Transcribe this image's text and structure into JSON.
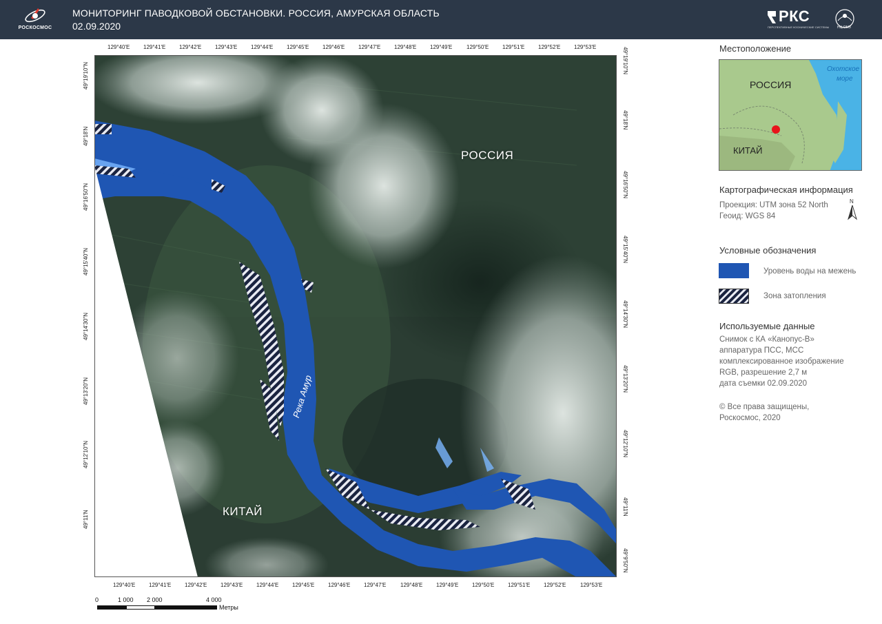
{
  "header": {
    "logo_left_text": "РОСКОСМОС",
    "title": "МОНИТОРИНГ ПАВОДКОВОЙ ОБСТАНОВКИ. РОССИЯ, АМУРСКАЯ ОБЛАСТЬ",
    "date": "02.09.2020",
    "logo_right_text": "РКС",
    "logo_right_sub": "ПЕРСПЕКТИВНЫЕ КОСМИЧЕСКИЕ СИСТЕМЫ",
    "emblem_text": "НЦ ОМЗ"
  },
  "map": {
    "label_russia": "РОССИЯ",
    "label_china": "КИТАЙ",
    "river_label": "Река Амур",
    "lon_ticks_top": [
      "129°40'E",
      "129°41'E",
      "129°42'E",
      "129°43'E",
      "129°44'E",
      "129°45'E",
      "129°46'E",
      "129°47'E",
      "129°48'E",
      "129°49'E",
      "129°50'E",
      "129°51'E",
      "129°52'E",
      "129°53'E"
    ],
    "lon_ticks_bottom": [
      "129°40'E",
      "129°41'E",
      "129°42'E",
      "129°43'E",
      "129°44'E",
      "129°45'E",
      "129°46'E",
      "129°47'E",
      "129°48'E",
      "129°49'E",
      "129°50'E",
      "129°51'E",
      "129°52'E",
      "129°53'E"
    ],
    "lat_ticks_left": [
      "49°19'10\"N",
      "49°18'N",
      "49°16'50\"N",
      "49°15'40\"N",
      "49°14'30\"N",
      "49°13'20\"N",
      "49°12'10\"N",
      "49°11'N"
    ],
    "lat_ticks_right": [
      "49°19'10\"N",
      "49°18'N",
      "49°16'50\"N",
      "49°15'40\"N",
      "49°14'30\"N",
      "49°13'20\"N",
      "49°12'10\"N",
      "49°11'N",
      "49°9'50\"N"
    ]
  },
  "scale": {
    "labels": [
      "0",
      "1 000",
      "2 000",
      "4 000"
    ],
    "unit": "Метры"
  },
  "panel": {
    "location_title": "Местоположение",
    "inset": {
      "russia": "РОССИЯ",
      "china": "КИТАЙ",
      "sea_line1": "Охотское",
      "sea_line2": "море"
    },
    "carto_title": "Картографическая информация",
    "projection": "Проекция: UTM зона 52 North",
    "geoid": "Геоид: WGS 84",
    "north_label": "N",
    "legend_title": "Условные обозначения",
    "legend": [
      {
        "label": "Уровень воды на межень",
        "color": "#1f56b3"
      },
      {
        "label": "Зона затопления",
        "color": "#1a2340"
      }
    ],
    "data_title": "Используемые данные",
    "data_lines": [
      "Снимок с КА «Канопус-В»",
      "аппаратура ПСС, МСС",
      "комплексированное изображение",
      "RGB, разрешение 2,7 м",
      "дата съемки 02.09.2020"
    ],
    "copyright_lines": [
      "© Все права защищены,",
      "Роскосмос, 2020"
    ]
  },
  "colors": {
    "header_bg": "#2c3848",
    "water": "#1f56b3",
    "flood_hatch": "#1a2340",
    "land_dark": "#22332c",
    "inset_sea": "#4ab3e6",
    "inset_land": "#a9c98d",
    "location_marker": "#e8141b"
  }
}
